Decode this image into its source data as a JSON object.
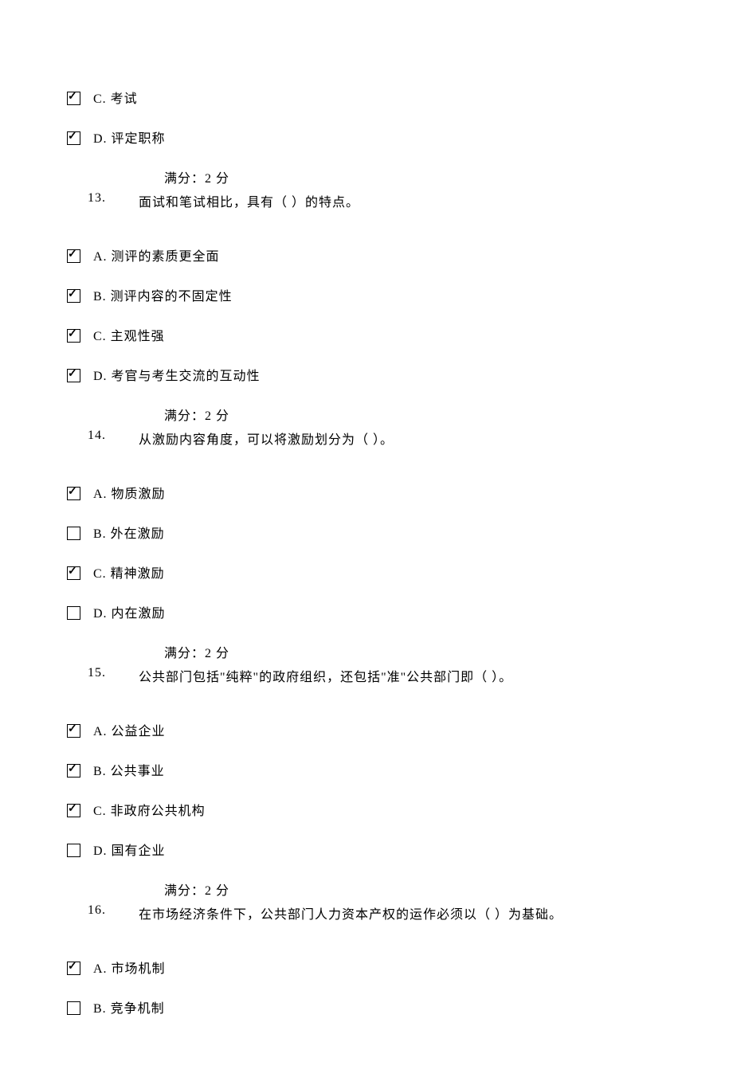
{
  "partial_question": {
    "options": [
      {
        "checked": true,
        "label": "C. 考试"
      },
      {
        "checked": true,
        "label": "D. 评定职称"
      }
    ]
  },
  "score_label": "满分：2    分",
  "questions": [
    {
      "num": "13.",
      "text": "面试和笔试相比，具有（    ）的特点。",
      "options": [
        {
          "checked": true,
          "label": "A. 测评的素质更全面"
        },
        {
          "checked": true,
          "label": "B. 测评内容的不固定性"
        },
        {
          "checked": true,
          "label": "C. 主观性强"
        },
        {
          "checked": true,
          "label": "D. 考官与考生交流的互动性"
        }
      ]
    },
    {
      "num": "14.",
      "text": "从激励内容角度，可以将激励划分为（    ）。",
      "options": [
        {
          "checked": true,
          "label": "A. 物质激励"
        },
        {
          "checked": false,
          "label": "B. 外在激励"
        },
        {
          "checked": true,
          "label": "C. 精神激励"
        },
        {
          "checked": false,
          "label": "D. 内在激励"
        }
      ]
    },
    {
      "num": "15.",
      "text": "公共部门包括\"纯粹\"的政府组织，还包括\"准\"公共部门即（    ）。",
      "options": [
        {
          "checked": true,
          "label": "A. 公益企业"
        },
        {
          "checked": true,
          "label": "B. 公共事业"
        },
        {
          "checked": true,
          "label": "C. 非政府公共机构"
        },
        {
          "checked": false,
          "label": "D. 国有企业"
        }
      ]
    },
    {
      "num": "16.",
      "text": "在市场经济条件下，公共部门人力资本产权的运作必须以（    ）为基础。",
      "options": [
        {
          "checked": true,
          "label": "A. 市场机制"
        },
        {
          "checked": false,
          "label": "B. 竞争机制"
        }
      ]
    }
  ]
}
